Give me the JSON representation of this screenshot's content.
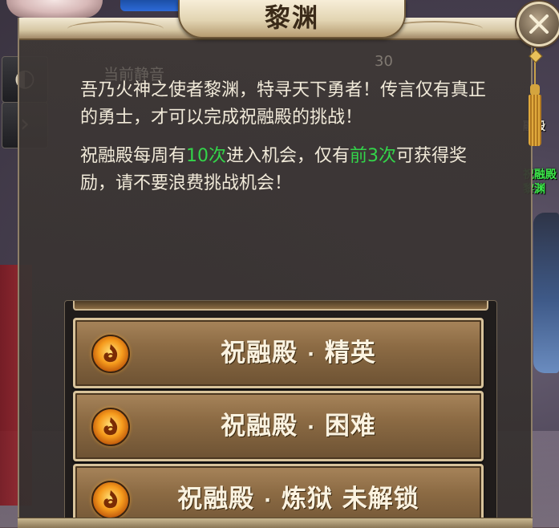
{
  "dialog": {
    "title": "黎渊",
    "ghost_label": "当前静音",
    "ghost_number": "30",
    "intro": "吾乃火神之使者黎渊，特寻天下勇者！传言仅有真正的勇士，才可以完成祝融殿的挑战！",
    "rule": {
      "part1": "祝融殿每周有",
      "highlight1": "10次",
      "part2": "进入机会，仅有",
      "highlight2": "前3次",
      "part3": "可获得奖励，请不要浪费挑战机会！"
    },
    "modes": [
      {
        "name": "祝融殿",
        "sep": "·",
        "level": "精英"
      },
      {
        "name": "祝融殿",
        "sep": "·",
        "level": "困难"
      },
      {
        "name": "祝融殿",
        "sep": "·",
        "level": "炼狱 未解锁"
      }
    ],
    "mode_icon": "flame-icon",
    "close_icon": "close-icon"
  },
  "scene": {
    "npc_name_1": "融殿",
    "npc_name_2": "祝融殿",
    "npc_name_3": "黎渊"
  },
  "colors": {
    "highlight": "#33d44a",
    "text": "#f1ead9",
    "button_border": "#d8c39b",
    "button_fill": "#8c6b44"
  }
}
